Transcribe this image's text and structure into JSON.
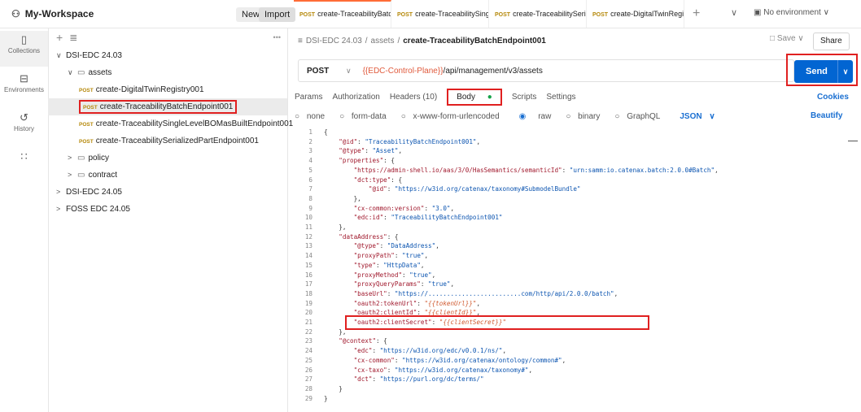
{
  "workspace": {
    "name": "My-Workspace",
    "new_label": "New",
    "import_label": "Import"
  },
  "tabs": [
    {
      "method": "POST",
      "label": "create-TraceabilityBatc"
    },
    {
      "method": "POST",
      "label": "create-TraceabilitySing"
    },
    {
      "method": "POST",
      "label": "create-TraceabilitySeri"
    },
    {
      "method": "POST",
      "label": "create-DigitalTwinRegi"
    }
  ],
  "environment": "No environment",
  "rail": [
    {
      "icon": "collections-icon",
      "label": "Collections"
    },
    {
      "icon": "environments-icon",
      "label": "Environments"
    },
    {
      "icon": "history-icon",
      "label": "History"
    },
    {
      "icon": "apps-icon",
      "label": ""
    }
  ],
  "sidebar": {
    "more": "•••",
    "tree": [
      {
        "depth": 0,
        "chev": "∨",
        "label": "DSI-EDC 24.03"
      },
      {
        "depth": 1,
        "chev": "∨",
        "folder": true,
        "label": "assets"
      },
      {
        "depth": 2,
        "method": "POST",
        "label": "create-DigitalTwinRegistry001"
      },
      {
        "depth": 2,
        "method": "POST",
        "label": "create-TraceabilityBatchEndpoint001",
        "selected": true
      },
      {
        "depth": 2,
        "method": "POST",
        "label": "create-TraceabilitySingleLevelBOMasBuiltEndpoint001"
      },
      {
        "depth": 2,
        "method": "POST",
        "label": "create-TraceabilitySerializedPartEndpoint001"
      },
      {
        "depth": 1,
        "chev": ">",
        "folder": true,
        "label": "policy"
      },
      {
        "depth": 1,
        "chev": ">",
        "folder": true,
        "label": "contract"
      },
      {
        "depth": 0,
        "chev": ">",
        "label": "DSI-EDC 24.05"
      },
      {
        "depth": 0,
        "chev": ">",
        "label": "FOSS EDC 24.05"
      }
    ]
  },
  "request": {
    "breadcrumb_root": "DSI-EDC 24.03",
    "breadcrumb_mid": "assets",
    "breadcrumb_leaf": "create-TraceabilityBatchEndpoint001",
    "save_label": "Save",
    "share_label": "Share",
    "method": "POST",
    "url_var": "{{EDC-Control-Plane}}",
    "url_path": "/api/management/v3/assets",
    "send_label": "Send",
    "tabs": [
      "Params",
      "Authorization",
      "Headers (10)",
      "Body",
      "Scripts",
      "Settings"
    ],
    "cookies_label": "Cookies",
    "body_modes": [
      "none",
      "form-data",
      "x-www-form-urlencoded",
      "raw",
      "binary",
      "GraphQL"
    ],
    "format": "JSON",
    "beautify_label": "Beautify"
  },
  "code_lines": [
    "{",
    "    \"@id\": \"TraceabilityBatchEndpoint001\",",
    "    \"@type\": \"Asset\",",
    "    \"properties\": {",
    "        \"https://admin-shell.io/aas/3/0/HasSemantics/semanticId\": \"urn:samm:io.catenax.batch:2.0.0#Batch\",",
    "        \"dct:type\": {",
    "            \"@id\": \"https://w3id.org/catenax/taxonomy#SubmodelBundle\"",
    "        },",
    "        \"cx-common:version\": \"3.0\",",
    "        \"edc:id\": \"TraceabilityBatchEndpoint001\"",
    "    },",
    "    \"dataAddress\": {",
    "        \"@type\": \"DataAddress\",",
    "        \"proxyPath\": \"true\",",
    "        \"type\": \"HttpData\",",
    "        \"proxyMethod\": \"true\",",
    "        \"proxyQueryParams\": \"true\",",
    "        \"baseUrl\": \"https://.........................com/http/api/2.0.0/batch\",",
    "        \"oauth2:tokenUrl\": \"{{tokenUrl}}\",",
    "        \"oauth2:clientId\": \"{{clientId}}\",",
    "        \"oauth2:clientSecret\": \"{{clientSecret}}\"",
    "    },",
    "    \"@context\": {",
    "        \"edc\": \"https://w3id.org/edc/v0.0.1/ns/\",",
    "        \"cx-common\": \"https://w3id.org/catenax/ontology/common#\",",
    "        \"cx-taxo\": \"https://w3id.org/catenax/taxonomy#\",",
    "        \"dct\": \"https://purl.org/dc/terms/\"",
    "    }",
    "}"
  ]
}
